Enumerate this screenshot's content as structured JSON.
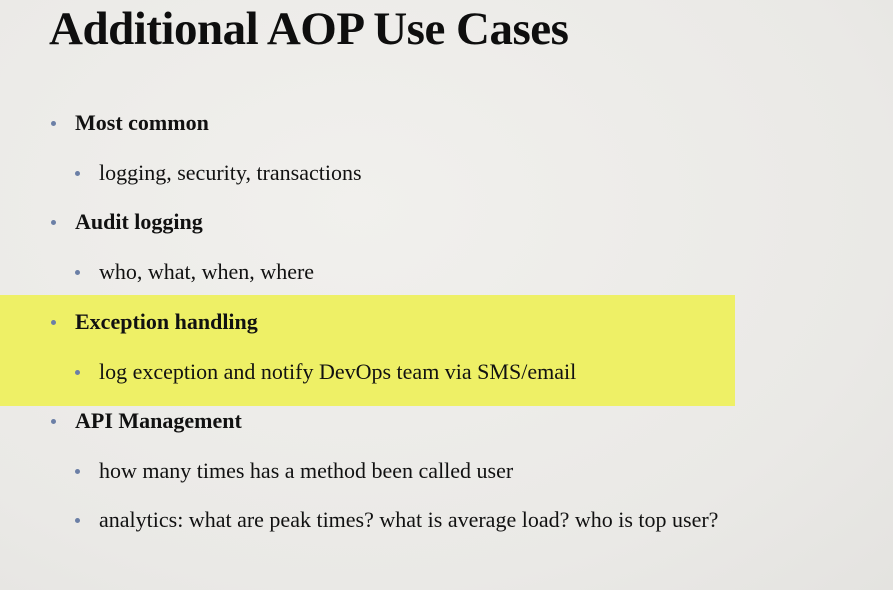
{
  "slide": {
    "title": "Additional AOP Use Cases",
    "highlight_color": "#eef066",
    "bullet_color": "#6b7fa6",
    "items": [
      {
        "label": "Most common",
        "subitems": [
          "logging, security, transactions"
        ]
      },
      {
        "label": "Audit logging",
        "subitems": [
          "who, what, when, where"
        ]
      },
      {
        "label": "Exception handling",
        "subitems": [
          "log exception and notify DevOps team via SMS/email"
        ],
        "highlighted": true
      },
      {
        "label": "API Management",
        "subitems": [
          "how many times has a method been called user",
          "analytics: what are peak times? what is average load?  who is top user?"
        ]
      }
    ]
  }
}
